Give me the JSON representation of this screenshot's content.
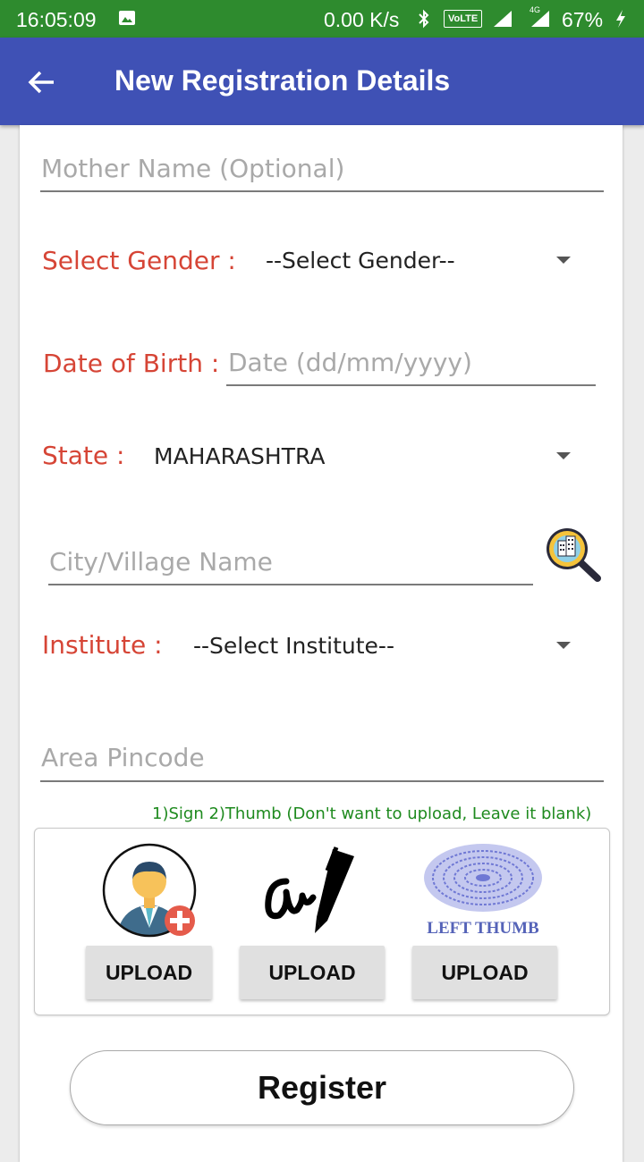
{
  "status_bar": {
    "time": "16:05:09",
    "speed": "0.00 K/s",
    "volte": "VoLTE",
    "network": "4G",
    "battery": "67%"
  },
  "app_bar": {
    "title": "New Registration Details"
  },
  "form": {
    "mother_name": {
      "placeholder": "Mother Name (Optional)",
      "value": ""
    },
    "gender": {
      "label": "Select Gender :",
      "selected": "--Select Gender--"
    },
    "dob": {
      "label": "Date of Birth :",
      "placeholder": "Date (dd/mm/yyyy)"
    },
    "state": {
      "label": "State :",
      "selected": "MAHARASHTRA"
    },
    "city": {
      "placeholder": "City/Village Name",
      "icon": "city-search-icon"
    },
    "institute": {
      "label": "Institute :",
      "selected": "--Select Institute--"
    },
    "pincode": {
      "placeholder": "Area Pincode"
    }
  },
  "uploads": {
    "note": "1)Sign 2)Thumb (Don't want to upload, Leave it blank)",
    "thumb_caption": "LEFT THUMB",
    "items": [
      {
        "icon": "add-user-photo-icon",
        "button": "UPLOAD"
      },
      {
        "icon": "signature-icon",
        "button": "UPLOAD"
      },
      {
        "icon": "left-thumb-icon",
        "button": "UPLOAD"
      }
    ]
  },
  "register": {
    "label": "Register"
  },
  "colors": {
    "status_bar": "#2e8b2e",
    "app_bar": "#3f51b5",
    "label_red": "#d64536",
    "note_green": "#1e8a1e"
  }
}
